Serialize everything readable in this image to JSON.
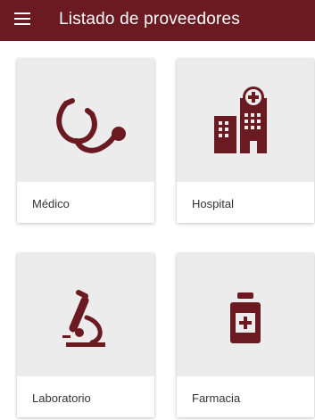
{
  "appbar": {
    "title": "Listado de proveedores",
    "menu_icon": "hamburger-menu-icon",
    "background": "#6b1a22"
  },
  "accent_color": "#6b1a22",
  "providers": [
    {
      "label": "Médico",
      "icon": "stethoscope-icon"
    },
    {
      "label": "Hospital",
      "icon": "hospital-building-icon"
    },
    {
      "label": "Laboratorio",
      "icon": "microscope-icon"
    },
    {
      "label": "Farmacia",
      "icon": "medicine-bottle-icon"
    }
  ]
}
